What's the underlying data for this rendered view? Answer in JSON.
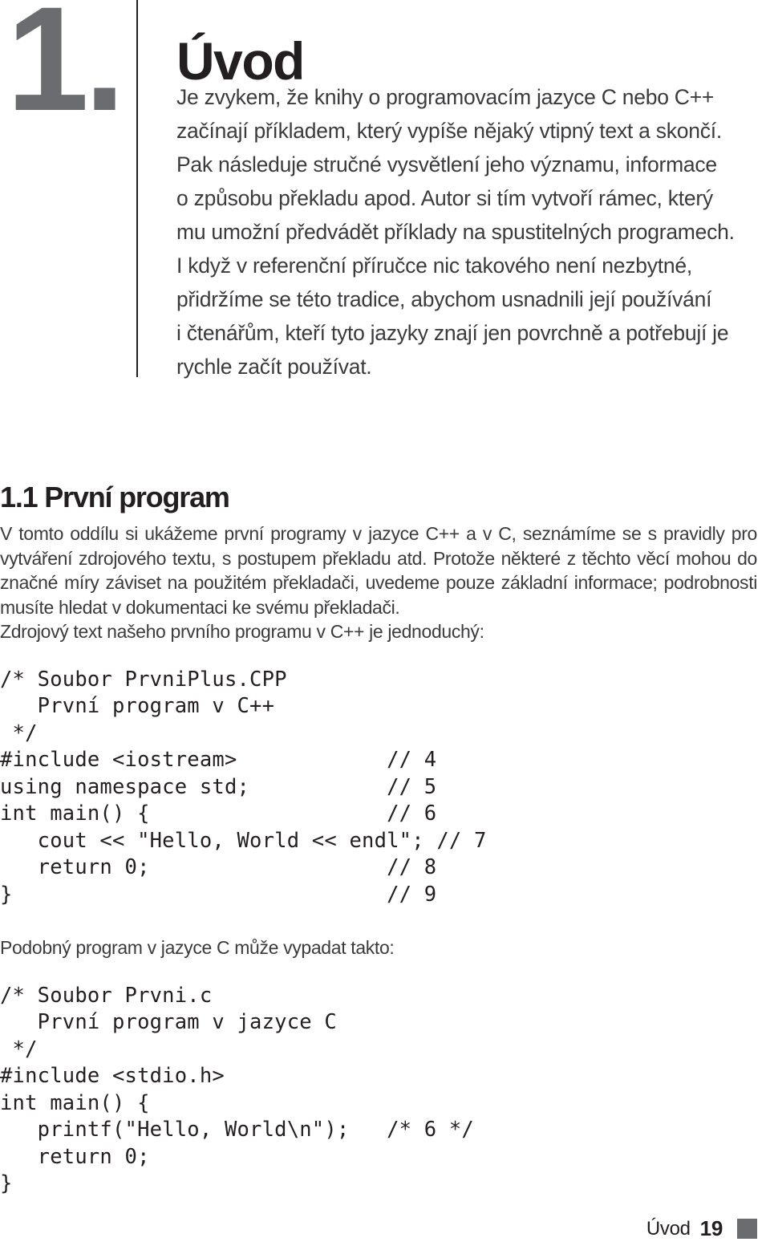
{
  "chapter": {
    "number": "1.",
    "title": "Úvod",
    "intro_lines": [
      "Je zvykem, že knihy o programovacím jazyce C nebo C++",
      "začínají příkladem, který vypíše nějaký vtipný text a skončí.",
      "Pak následuje stručné vysvětlení jeho významu, informace",
      "o způsobu překladu apod. Autor si tím vytvoří rámec, který",
      "mu umožní předvádět příklady na spustitelných programech.",
      "I když v referenční příručce nic takového není nezbytné,",
      "přidržíme se této tradice, abychom usnadnili její používání",
      "i čtenářům, kteří tyto jazyky znají jen povrchně a potřebují je",
      "rychle začít používat."
    ]
  },
  "section": {
    "heading": "1.1 První program",
    "paragraph": "V tomto oddílu si ukážeme první programy v jazyce C++ a v C, seznámíme se s pravidly pro vytváření zdrojového textu, s postupem překladu atd. Protože některé z těchto věcí mohou do značné míry záviset na použitém překladači, uvedeme pouze základní informace; podrobnosti musíte hledat v dokumentaci ke svému překladači.",
    "lead_cpp": "Zdrojový text našeho prvního programu v C++ je jednoduchý:",
    "lead_c": "Podobný program v jazyce C může vypadat takto:"
  },
  "code_cpp": {
    "lines": [
      "/* Soubor PrvniPlus.CPP",
      "   První program v C++",
      " */",
      "#include <iostream>            // 4",
      "using namespace std;           // 5",
      "int main() {                   // 6",
      "   cout << \"Hello, World << endl\"; // 7",
      "   return 0;                   // 8",
      "}                              // 9"
    ]
  },
  "code_c": {
    "lines": [
      "/* Soubor Prvni.c",
      "   První program v jazyce C",
      " */",
      "#include <stdio.h>",
      "int main() {",
      "   printf(\"Hello, World\\n\");   /* 6 */",
      "   return 0;",
      "}"
    ]
  },
  "footer": {
    "label": "Úvod",
    "page_number": "19"
  },
  "colors": {
    "accent_gray": "#6a6c6f",
    "text": "#231f20",
    "body_text": "#3b3b3d"
  }
}
